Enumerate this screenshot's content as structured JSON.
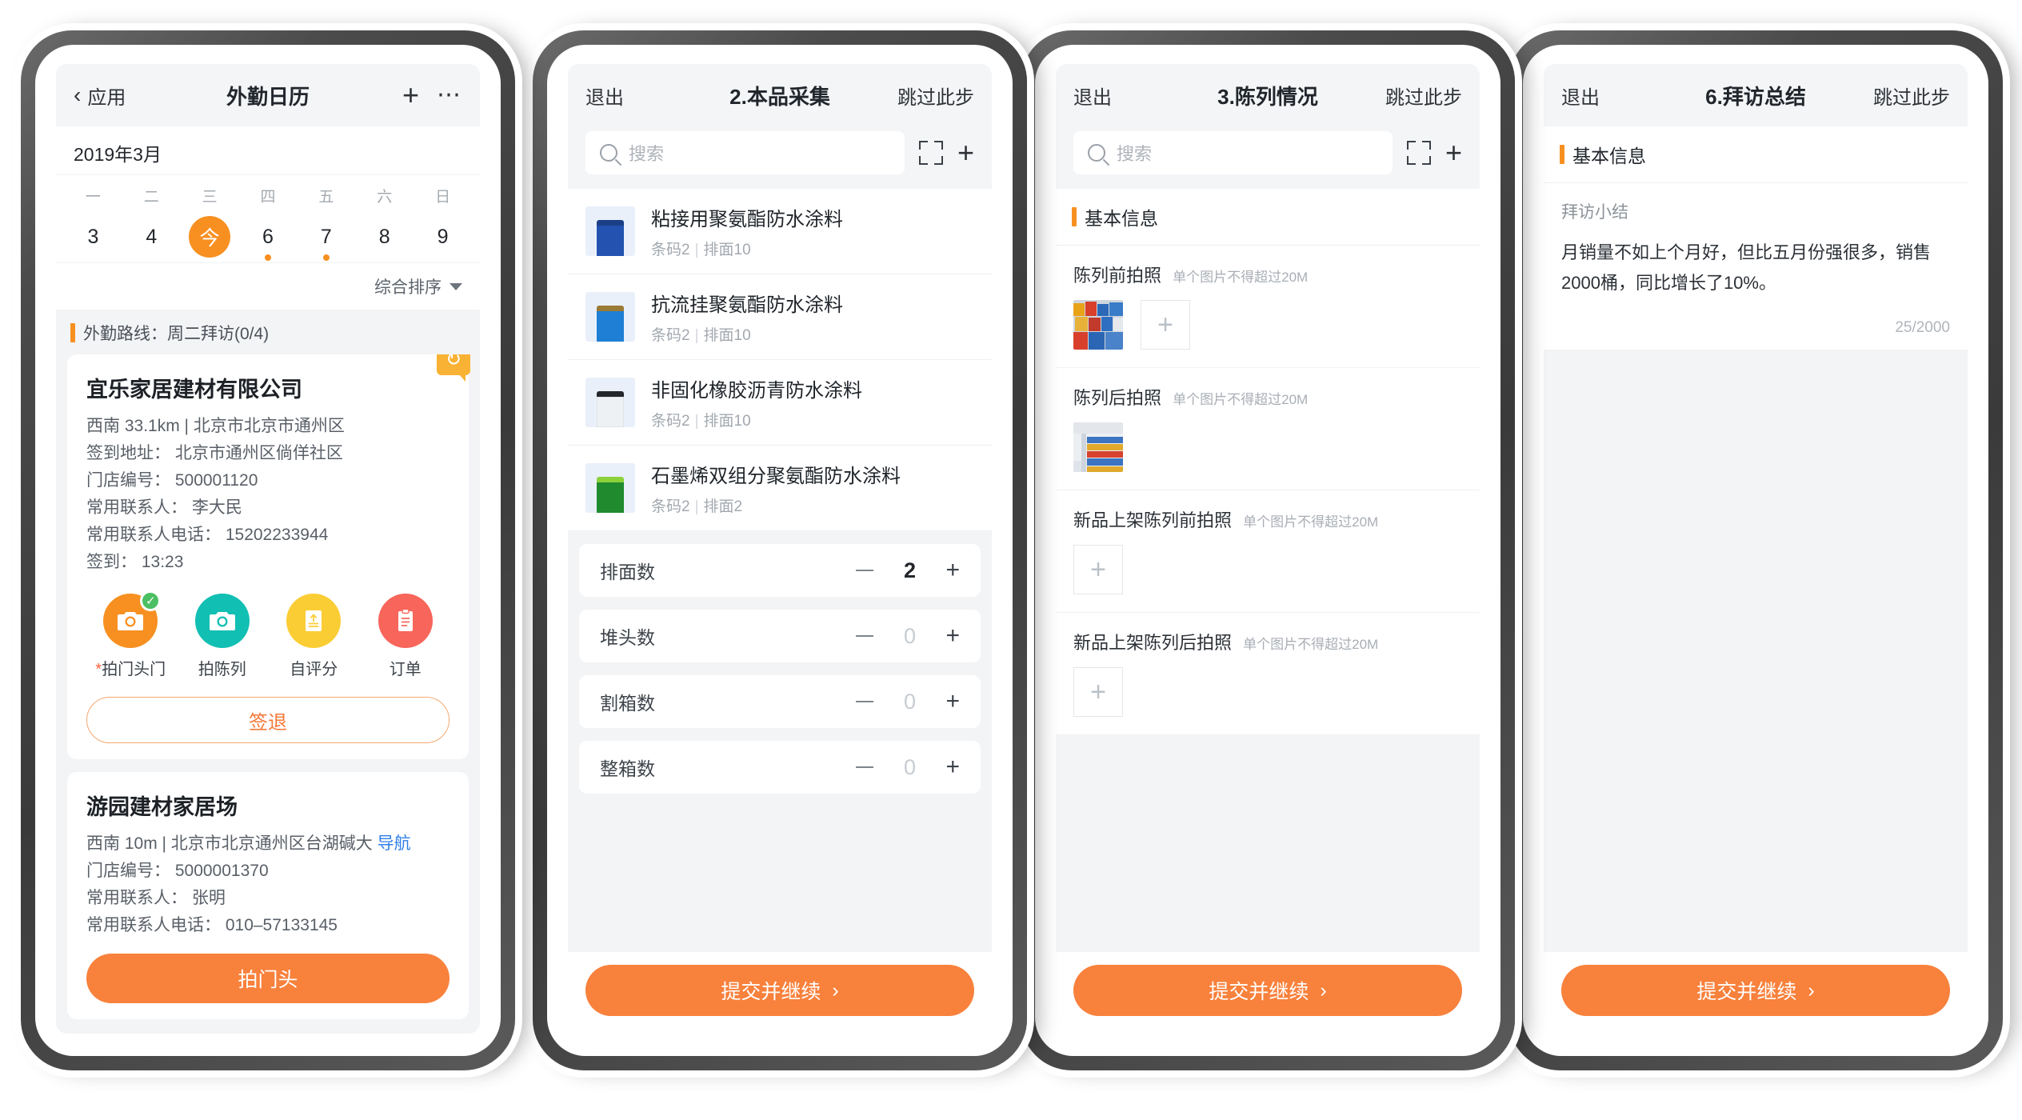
{
  "screen1": {
    "nav": {
      "back_label": "应用",
      "title": "外勤日历",
      "add_icon": "plus-icon",
      "more_icon": "more-icon"
    },
    "calendar": {
      "month_label": "2019年3月",
      "weekdays": [
        "一",
        "二",
        "三",
        "四",
        "五",
        "六",
        "日"
      ],
      "days": [
        "3",
        "4",
        "今",
        "6",
        "7",
        "8",
        "9"
      ],
      "today_index": 2,
      "dot_days": [
        3,
        4
      ],
      "sort_label": "综合排序"
    },
    "route_label": "外勤路线：周二拜访(0/4)",
    "stores": [
      {
        "name": "宜乐家居建材有限公司",
        "distance": "西南 33.1km | 北京市北京市通州区",
        "checkin_address": "签到地址： 北京市通州区倘佯社区",
        "store_code": "门店编号： 500001120",
        "contact": "常用联系人： 李大民",
        "contact_phone": "常用联系人电话： 15202233944",
        "checkin_time": "签到： 13:23",
        "sync_icon": "refresh-icon",
        "actions": [
          {
            "label": "拍门头门",
            "required": true,
            "color": "#f79021",
            "icon": "camera-icon",
            "done": true
          },
          {
            "label": "拍陈列",
            "required": false,
            "color": "#12bfb3",
            "icon": "camera-icon",
            "done": false
          },
          {
            "label": "自评分",
            "required": false,
            "color": "#fbcd35",
            "icon": "upload-icon",
            "done": false
          },
          {
            "label": "订单",
            "required": false,
            "color": "#f8655a",
            "icon": "clipboard-icon",
            "done": false
          }
        ],
        "button": "签退"
      },
      {
        "name": "游园建材家居场",
        "distance": "西南 10m | 北京市北京通州区台湖碱大",
        "nav_link": "导航",
        "store_code": "门店编号： 5000001370",
        "contact": "常用联系人： 张明",
        "contact_phone": "常用联系人电话： 010–57133145",
        "button": "拍门头"
      }
    ]
  },
  "screen2": {
    "nav": {
      "exit": "退出",
      "title": "2.本品采集",
      "skip": "跳过此步"
    },
    "search": {
      "placeholder": "搜索",
      "search_icon": "search-icon",
      "scan_icon": "scan-icon",
      "add_icon": "plus-icon"
    },
    "products": [
      {
        "name": "粘接用聚氨酯防水涂料",
        "barcode": "条码2",
        "facing": "排面10",
        "lid": "#1b3f86",
        "body": "#2352b0"
      },
      {
        "name": "抗流挂聚氨酯防水涂料",
        "barcode": "条码2",
        "facing": "排面10",
        "lid": "#9a7a34",
        "body": "#1e7fd4"
      },
      {
        "name": "非固化橡胶沥青防水涂料",
        "barcode": "条码2",
        "facing": "排面10",
        "lid": "#23272c",
        "body": "#f4f6f8"
      },
      {
        "name": "石墨烯双组分聚氨酯防水涂料",
        "barcode": "条码2",
        "facing": "排面2",
        "lid": "#8bd13a",
        "body": "#1f8b2e"
      }
    ],
    "counters": [
      {
        "label": "排面数",
        "value": "2"
      },
      {
        "label": "堆头数",
        "value": "0"
      },
      {
        "label": "割箱数",
        "value": "0"
      },
      {
        "label": "整箱数",
        "value": "0"
      }
    ],
    "submit": "提交并继续"
  },
  "screen3": {
    "nav": {
      "exit": "退出",
      "title": "3.陈列情况",
      "skip": "跳过此步"
    },
    "search": {
      "placeholder": "搜索",
      "search_icon": "search-icon",
      "scan_icon": "scan-icon",
      "add_icon": "plus-icon"
    },
    "section_title": "基本信息",
    "photo_groups": [
      {
        "label": "陈列前拍照",
        "hint": "单个图片不得超过20M",
        "has_photo": true,
        "has_add": true
      },
      {
        "label": "陈列后拍照",
        "hint": "单个图片不得超过20M",
        "has_photo": true,
        "has_add": false
      },
      {
        "label": "新品上架陈列前拍照",
        "hint": "单个图片不得超过20M",
        "has_photo": false,
        "has_add": true
      },
      {
        "label": "新品上架陈列后拍照",
        "hint": "单个图片不得超过20M",
        "has_photo": false,
        "has_add": true
      }
    ],
    "submit": "提交并继续"
  },
  "screen4": {
    "nav": {
      "exit": "退出",
      "title": "6.拜访总结",
      "skip": "跳过此步"
    },
    "section_title": "基本信息",
    "summary_label": "拜访小结",
    "summary_text": "月销量不如上个月好，但比五月份强很多，销售2000桶，同比增长了10%。",
    "char_count": "25/2000",
    "submit": "提交并继续"
  },
  "theme": {
    "orange": "#f8813c",
    "accent": "#f79021",
    "blue_link": "#2f7fe8",
    "green": "#4cbf63"
  }
}
